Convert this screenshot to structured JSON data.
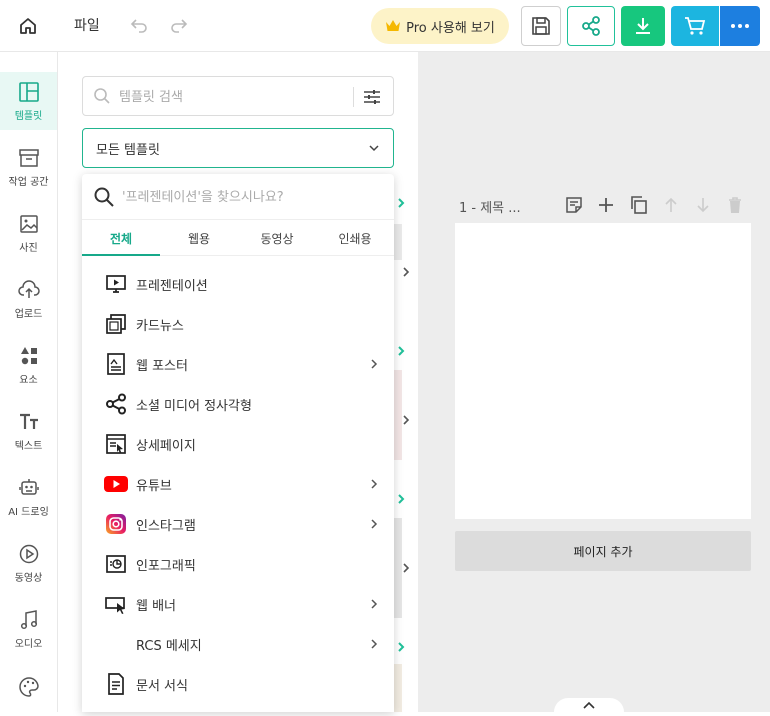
{
  "topbar": {
    "file_label": "파일",
    "pro_label": "Pro 사용해 보기"
  },
  "sidebar": {
    "items": [
      {
        "label": "템플릿",
        "icon": "template-icon",
        "active": true
      },
      {
        "label": "작업 공간",
        "icon": "archive-icon"
      },
      {
        "label": "사진",
        "icon": "image-icon"
      },
      {
        "label": "업로드",
        "icon": "upload-cloud-icon"
      },
      {
        "label": "요소",
        "icon": "shapes-icon"
      },
      {
        "label": "텍스트",
        "icon": "text-icon"
      },
      {
        "label": "AI 드로잉",
        "icon": "ai-robot-icon"
      },
      {
        "label": "동영상",
        "icon": "video-play-icon"
      },
      {
        "label": "오디오",
        "icon": "music-note-icon"
      },
      {
        "label": "",
        "icon": "palette-icon"
      }
    ]
  },
  "panel": {
    "search_placeholder": "템플릿 검색",
    "dropdown_value": "모든 템플릿"
  },
  "popup": {
    "search_placeholder": "'프레젠테이션'을 찾으시나요?",
    "tabs": [
      {
        "label": "전체",
        "active": true
      },
      {
        "label": "웹용"
      },
      {
        "label": "동영상"
      },
      {
        "label": "인쇄용"
      }
    ],
    "items": [
      {
        "label": "프레젠테이션",
        "icon": "presentation-icon",
        "has_submenu": false
      },
      {
        "label": "카드뉴스",
        "icon": "card-news-icon",
        "has_submenu": false
      },
      {
        "label": "웹 포스터",
        "icon": "web-poster-icon",
        "has_submenu": true
      },
      {
        "label": "소셜 미디어 정사각형",
        "icon": "social-share-icon",
        "has_submenu": false
      },
      {
        "label": "상세페이지",
        "icon": "detail-page-icon",
        "has_submenu": false
      },
      {
        "label": "유튜브",
        "icon": "youtube-icon",
        "has_submenu": true
      },
      {
        "label": "인스타그램",
        "icon": "instagram-icon",
        "has_submenu": true
      },
      {
        "label": "인포그래픽",
        "icon": "infographic-icon",
        "has_submenu": false
      },
      {
        "label": "웹 배너",
        "icon": "web-banner-icon",
        "has_submenu": true
      },
      {
        "label": "RCS 메세지",
        "icon": "",
        "has_submenu": true
      },
      {
        "label": "문서 서식",
        "icon": "document-icon",
        "has_submenu": false
      }
    ]
  },
  "canvas": {
    "page_title": "1 - 제목 ...",
    "add_page_label": "페이지 추가"
  },
  "colors": {
    "accent": "#17a98a",
    "download": "#17c77e",
    "cart": "#1cb5e0",
    "more": "#1d7fe0",
    "pro_bg": "#fdf3c8",
    "youtube": "#ff0000"
  }
}
